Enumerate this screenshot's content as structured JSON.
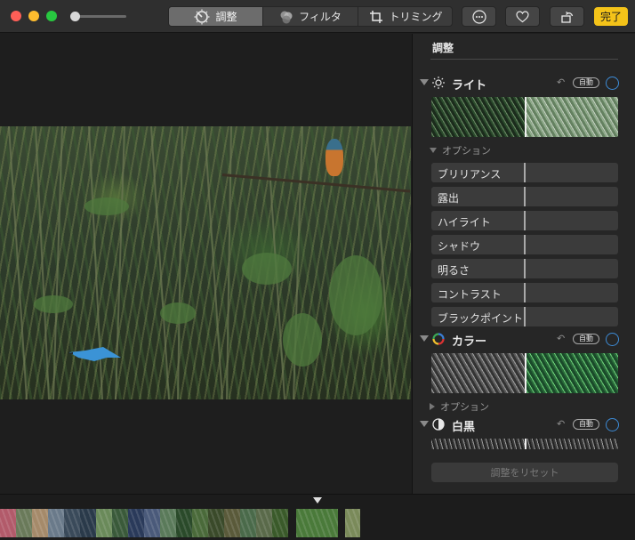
{
  "toolbar": {
    "segments": [
      {
        "label": "調整",
        "icon": "adjust-dial-icon",
        "active": true
      },
      {
        "label": "フィルタ",
        "icon": "filters-icon",
        "active": false
      },
      {
        "label": "トリミング",
        "icon": "crop-icon",
        "active": false
      }
    ],
    "done_label": "完了"
  },
  "panel": {
    "title": "調整",
    "light": {
      "label": "ライト",
      "auto_label": "自動",
      "options_label": "オプション"
    },
    "sliders": [
      "ブリリアンス",
      "露出",
      "ハイライト",
      "シャドウ",
      "明るさ",
      "コントラスト",
      "ブラックポイント"
    ],
    "color": {
      "label": "カラー",
      "auto_label": "自動",
      "options_label": "オプション"
    },
    "bw": {
      "label": "白黒",
      "auto_label": "自動"
    },
    "reset_label": "調整をリセット"
  },
  "colors": {
    "accent_blue": "#3d8bd6",
    "done_yellow": "#f4c319"
  },
  "filmstrip": {
    "thumbnail_colors": [
      "#b25a6a",
      "#6a7a5a",
      "#a58a6a",
      "#6a7a8a",
      "#3a4a5a",
      "#2a3a4a",
      "#6a8a5a",
      "#3a5a3a",
      "#2a3a5a",
      "#4a5a7a",
      "#5a7a5a",
      "#2a4a2a",
      "#4a6a3a",
      "#3a4a2a",
      "#5a5a3a",
      "#4a6a4a",
      "#5a6a4a",
      "#3a5a2a",
      "#4a7a3a",
      "#7a8a5a"
    ]
  }
}
